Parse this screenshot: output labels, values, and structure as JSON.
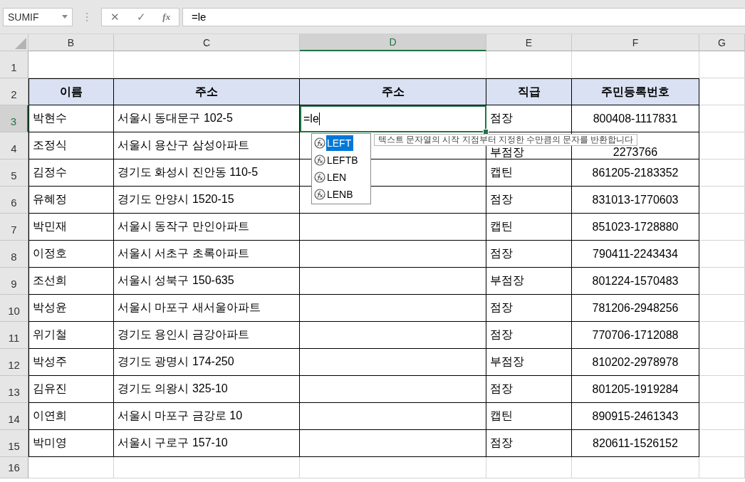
{
  "name_box": "SUMIF",
  "formula_bar": {
    "cancel": "✕",
    "enter": "✓",
    "function": "fx",
    "value": "=le"
  },
  "columns": [
    {
      "label": "B",
      "selected": false
    },
    {
      "label": "C",
      "selected": false
    },
    {
      "label": "D",
      "selected": true
    },
    {
      "label": "E",
      "selected": false
    },
    {
      "label": "F",
      "selected": false
    },
    {
      "label": "G",
      "selected": false
    }
  ],
  "row_headers": [
    {
      "label": "1",
      "selected": false
    },
    {
      "label": "2",
      "selected": false
    },
    {
      "label": "3",
      "selected": true
    },
    {
      "label": "4",
      "selected": false
    },
    {
      "label": "5",
      "selected": false
    },
    {
      "label": "6",
      "selected": false
    },
    {
      "label": "7",
      "selected": false
    },
    {
      "label": "8",
      "selected": false
    },
    {
      "label": "9",
      "selected": false
    },
    {
      "label": "10",
      "selected": false
    },
    {
      "label": "11",
      "selected": false
    },
    {
      "label": "12",
      "selected": false
    },
    {
      "label": "13",
      "selected": false
    },
    {
      "label": "14",
      "selected": false
    },
    {
      "label": "15",
      "selected": false
    },
    {
      "label": "16",
      "selected": false
    }
  ],
  "table": {
    "headers": [
      "이름",
      "주소",
      "주소",
      "직급",
      "주민등록번호"
    ],
    "rows": [
      {
        "name": "박현수",
        "address": "서울시 동대문구 102-5",
        "editing": "=le",
        "position": "점장",
        "id_number": "800408-1117831"
      },
      {
        "name": "조정식",
        "address": "서울시 용산구 삼성아파트",
        "position": "부점장",
        "id_number": "2273766"
      },
      {
        "name": "김정수",
        "address": "경기도 화성시 진안동 110-5",
        "position": "캡틴",
        "id_number": "861205-2183352"
      },
      {
        "name": "유혜정",
        "address": "경기도 안양시 1520-15",
        "position": "점장",
        "id_number": "831013-1770603"
      },
      {
        "name": "박민재",
        "address": "서울시 동작구 만인아파트",
        "position": "캡틴",
        "id_number": "851023-1728880"
      },
      {
        "name": "이정호",
        "address": "서울시 서초구 초록아파트",
        "position": "점장",
        "id_number": "790411-2243434"
      },
      {
        "name": "조선희",
        "address": "서울시 성북구 150-635",
        "position": "부점장",
        "id_number": "801224-1570483"
      },
      {
        "name": "박성윤",
        "address": "서울시 마포구 새서울아파트",
        "position": "점장",
        "id_number": "781206-2948256"
      },
      {
        "name": "위기철",
        "address": "경기도 용인시 금강아파트",
        "position": "점장",
        "id_number": "770706-1712088"
      },
      {
        "name": "박성주",
        "address": "경기도 광명시 174-250",
        "position": "부점장",
        "id_number": "810202-2978978"
      },
      {
        "name": "김유진",
        "address": "경기도 의왕시 325-10",
        "position": "점장",
        "id_number": "801205-1919284"
      },
      {
        "name": "이연희",
        "address": "서울시 마포구 금강로 10",
        "position": "캡틴",
        "id_number": "890915-2461343"
      },
      {
        "name": "박미영",
        "address": "서울시 구로구 157-10",
        "position": "점장",
        "id_number": "820611-1526152"
      }
    ]
  },
  "autocomplete": {
    "items": [
      {
        "name": "LEFT",
        "selected": true
      },
      {
        "name": "LEFTB",
        "selected": false
      },
      {
        "name": "LEN",
        "selected": false
      },
      {
        "name": "LENB",
        "selected": false
      }
    ],
    "tooltip": "텍스트 문자열의 시작 지점부터 지정한 수만큼의 문자를 반환합니다"
  }
}
